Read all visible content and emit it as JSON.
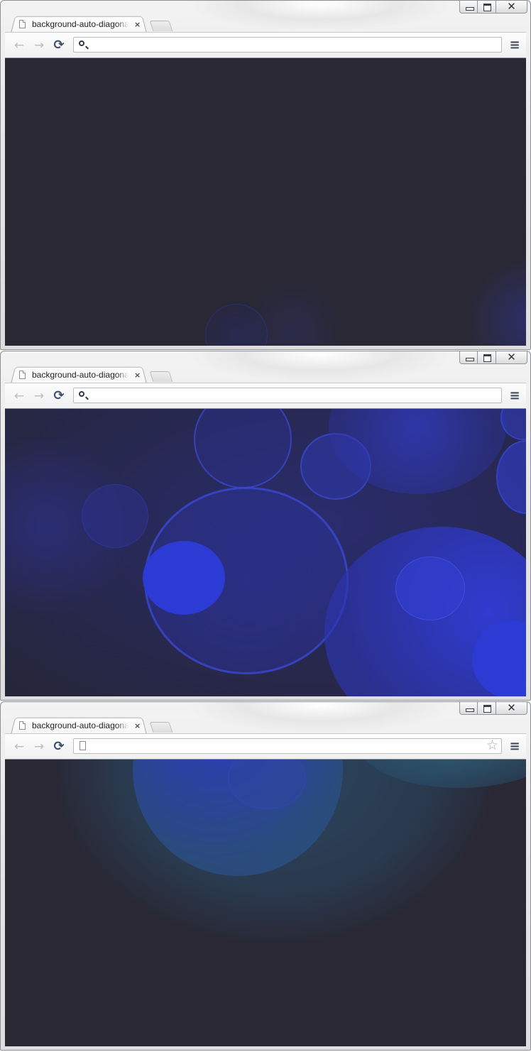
{
  "windows": [
    {
      "tab": {
        "title": "background-auto-diagonal",
        "close": "×"
      },
      "toolbar": {
        "back": "←",
        "forward": "→",
        "reload": "⟳",
        "menu": "≡"
      },
      "omnibox": {
        "value": "",
        "left_icon": "search-icon",
        "show_star": false
      },
      "caption": {
        "minimize": "minimize-icon",
        "maximize": "maximize-icon",
        "close": "✕"
      },
      "content": {
        "background": "#292834",
        "accent": "#2b34c9"
      }
    },
    {
      "tab": {
        "title": "background-auto-diagonal",
        "close": "×"
      },
      "toolbar": {
        "back": "←",
        "forward": "→",
        "reload": "⟳",
        "menu": "≡"
      },
      "omnibox": {
        "value": "",
        "left_icon": "search-icon",
        "show_star": false
      },
      "caption": {
        "minimize": "minimize-icon",
        "maximize": "maximize-icon",
        "close": "✕"
      },
      "content": {
        "background": "#282a58",
        "accent": "#2c38d2"
      }
    },
    {
      "tab": {
        "title": "background-auto-diagonal",
        "close": "×"
      },
      "toolbar": {
        "back": "←",
        "forward": "→",
        "reload": "⟳",
        "menu": "≡"
      },
      "omnibox": {
        "value": "",
        "left_icon": "page-icon",
        "show_star": true,
        "star": "☆"
      },
      "caption": {
        "minimize": "minimize-icon",
        "maximize": "maximize-icon",
        "close": "✕"
      },
      "content": {
        "background": "#292834",
        "accent": "#2a4f7a"
      }
    }
  ]
}
